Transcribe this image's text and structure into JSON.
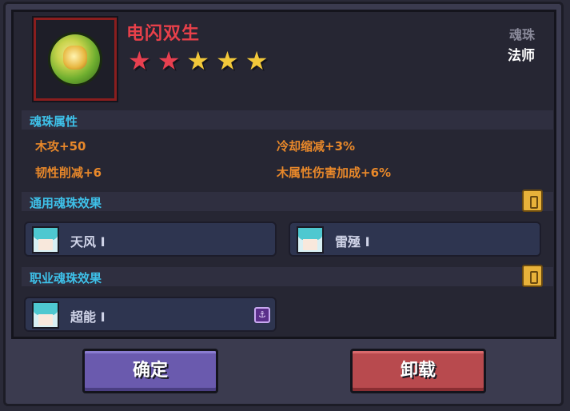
{
  "item": {
    "name": "电闪双生",
    "icon": "thunder-orb-icon",
    "category": "魂珠",
    "class": "法师",
    "stars": [
      {
        "icon": "star-icon",
        "color": "#e84050"
      },
      {
        "icon": "star-icon",
        "color": "#e84050"
      },
      {
        "icon": "star-icon",
        "color": "#f2c83a"
      },
      {
        "icon": "star-icon",
        "color": "#f2c83a"
      },
      {
        "icon": "star-icon",
        "color": "#f2c83a"
      }
    ]
  },
  "attributes": {
    "title": "魂珠属性",
    "items": [
      "木攻+50",
      "冷却缩减+3%",
      "韧性削减+6",
      "木属性伤害加成+6%"
    ]
  },
  "general_effects": {
    "title": "通用魂珠效果",
    "lock_icon": "lock-icon",
    "slots": [
      {
        "label": "天风 Ⅰ",
        "avatar": "hero-avatar-icon"
      },
      {
        "label": "雷殛 Ⅰ",
        "avatar": "hero-avatar-icon"
      }
    ]
  },
  "class_effects": {
    "title": "职业魂珠效果",
    "lock_icon": "lock-icon",
    "slots": [
      {
        "label": "超能 Ⅰ",
        "avatar": "hero-avatar-icon",
        "tag_icon": "mage-class-icon"
      }
    ]
  },
  "buttons": {
    "confirm": "确定",
    "unload": "卸载"
  },
  "colors": {
    "title": "#e8404a",
    "section": "#3ec0e8",
    "attribute": "#e8882a",
    "confirm_button": "#6a5aae",
    "unload_button": "#b84a4e"
  }
}
